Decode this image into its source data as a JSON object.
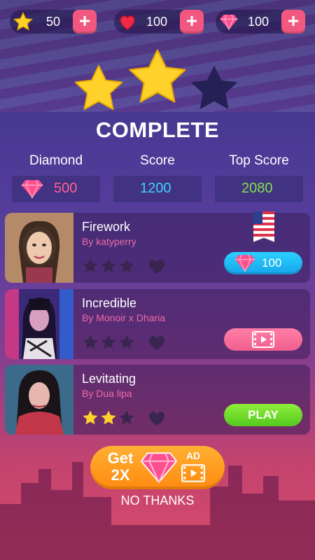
{
  "topbar": {
    "stars": {
      "value": "50",
      "icon": "star-icon"
    },
    "lives": {
      "value": "100",
      "icon": "heart-icon"
    },
    "diamonds": {
      "value": "100",
      "icon": "diamond-icon"
    },
    "plus_label": "+"
  },
  "result": {
    "stars_earned": 2,
    "stars_total": 3,
    "title": "COMPLETE"
  },
  "stats": {
    "diamond": {
      "label": "Diamond",
      "value": "500",
      "color": "#ff5f8f"
    },
    "score": {
      "label": "Score",
      "value": "1200",
      "color": "#3fd2ff"
    },
    "top_score": {
      "label": "Top Score",
      "value": "2080",
      "color": "#7fe24a"
    }
  },
  "songs": [
    {
      "title": "Firework",
      "artist": "By katyperry",
      "stars": 0,
      "action": "diamond",
      "price": "100",
      "badge": "us-flag"
    },
    {
      "title": "Incredible",
      "artist": "By Monoir x Dharia",
      "stars": 0,
      "action": "video"
    },
    {
      "title": "Levitating",
      "artist": "By Dua lipa",
      "stars": 2,
      "action": "play",
      "action_label": "PLAY"
    }
  ],
  "bonus": {
    "get_label": "Get",
    "multiplier": "2X",
    "ad_label": "AD"
  },
  "no_thanks": "NO THANKS",
  "colors": {
    "accent_pink": "#f2577f",
    "play_green": "#55c81e",
    "buy_blue": "#16a5ea",
    "gold": "#ffd22b"
  }
}
